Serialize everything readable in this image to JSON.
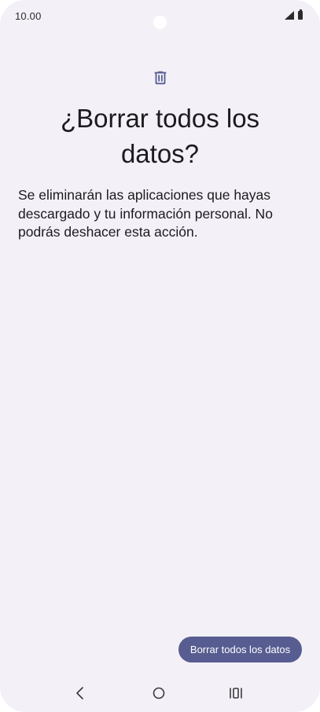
{
  "status_bar": {
    "time": "10.00",
    "icons": [
      "signal-icon",
      "battery-icon"
    ]
  },
  "content": {
    "icon": "trash-icon",
    "title": "¿Borrar todos los datos?",
    "description": "Se eliminarán las aplicaciones que hayas descargado y tu información personal. No podrás deshacer esta acción."
  },
  "actions": {
    "primary_label": "Borrar todos los datos"
  },
  "nav_bar": {
    "icons": [
      "back-icon",
      "home-icon",
      "recents-icon"
    ]
  },
  "colors": {
    "background": "#f3f0f7",
    "accent": "#585d91",
    "text": "#1c1b1f"
  }
}
